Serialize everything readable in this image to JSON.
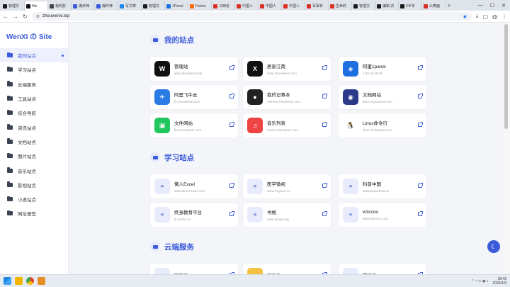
{
  "browser": {
    "tabs": [
      {
        "label": "管理文",
        "color": "#1a1a1a"
      },
      {
        "label": "We",
        "color": "#111111",
        "active": true
      },
      {
        "label": "我的影",
        "color": "#444444"
      },
      {
        "label": "爆炸神",
        "color": "#3b5bdb"
      },
      {
        "label": "爆炸神",
        "color": "#3b5bdb"
      },
      {
        "label": "写文章",
        "color": "#1e88e5"
      },
      {
        "label": "管理文",
        "color": "#1a1a1a"
      },
      {
        "label": "1Panel",
        "color": "#1e6fe0"
      },
      {
        "label": "Favico",
        "color": "#ff6a00"
      },
      {
        "label": "江西省",
        "color": "#d93025"
      },
      {
        "label": "中国人",
        "color": "#d93025"
      },
      {
        "label": "中国人",
        "color": "#d93025"
      },
      {
        "label": "中国人",
        "color": "#d93025"
      },
      {
        "label": "军事科",
        "color": "#d93025"
      },
      {
        "label": "生命的",
        "color": "#d93025"
      },
      {
        "label": "管理文",
        "color": "#1a1a1a"
      },
      {
        "label": "编辑 衣",
        "color": "#1a1a1a"
      },
      {
        "label": "3半年",
        "color": "#1a1a1a"
      },
      {
        "label": "公寓面",
        "color": "#d93025"
      }
    ],
    "url": "zhouwenxi.top"
  },
  "sidebar": {
    "logo": "WenXI の Site",
    "items": [
      {
        "label": "我的站点",
        "active": true
      },
      {
        "label": "学习站点"
      },
      {
        "label": "云端服务"
      },
      {
        "label": "工具站点"
      },
      {
        "label": "综合导航"
      },
      {
        "label": "资讯站点"
      },
      {
        "label": "文档站点"
      },
      {
        "label": "图片站点"
      },
      {
        "label": "音乐站点"
      },
      {
        "label": "影视站点"
      },
      {
        "label": "小说站点"
      },
      {
        "label": "网址便签"
      }
    ]
  },
  "sections": [
    {
      "title": "我的站点",
      "cards": [
        {
          "name": "管理站",
          "url": "www.zhouwenxi.top",
          "icon": "W",
          "bg": "#111111"
        },
        {
          "name": "居家江南",
          "url": "www.zhouwenxi.com",
          "icon": "X",
          "bg": "#111111"
        },
        {
          "name": "阿里1panel",
          "url": "1.92.26.48.93",
          "icon": "◈",
          "bg": "#1e6fe0"
        },
        {
          "name": "阿里飞牛云",
          "url": "fn.zhouwenxi.com",
          "icon": "✈",
          "bg": "#2a7be4"
        },
        {
          "name": "我的记事本",
          "url": "memos.zhouwenxi.com",
          "icon": "●",
          "bg": "#222222"
        },
        {
          "name": "文档网站",
          "url": "docs.zhouwenxi.com",
          "icon": "◉",
          "bg": "#2c3a8c"
        },
        {
          "name": "文件网站",
          "url": "file.zhouwenxi.com",
          "icon": "▣",
          "bg": "#22c55e"
        },
        {
          "name": "音乐列表",
          "url": "music.zhouwenxi.com",
          "icon": "♫",
          "bg": "#ef4444"
        },
        {
          "name": "Linux命令行",
          "url": "linux.zhouwenxi.com",
          "icon": "🐧",
          "bg": "#ffffff"
        }
      ]
    },
    {
      "title": "学习站点",
      "cards": [
        {
          "name": "懒人Excel",
          "url": "www.lanrenexcel.com",
          "icon": "⚭",
          "bg": "link"
        },
        {
          "name": "医学微视",
          "url": "www.mvyxws.cn",
          "icon": "⚭",
          "bg": "link"
        },
        {
          "name": "科普中国",
          "url": "www.kepuchina.cn",
          "icon": "⚭",
          "bg": "link"
        },
        {
          "name": "终身教育平台",
          "url": "le.ouchn.cn",
          "icon": "⚭",
          "bg": "link"
        },
        {
          "name": "书格",
          "url": "www.shuge.org",
          "icon": "⚭",
          "bg": "link"
        },
        {
          "name": "w3ccoo",
          "url": "www.w3ccoo.com",
          "icon": "⚭",
          "bg": "link"
        }
      ]
    },
    {
      "title": "云端服务",
      "cards": [
        {
          "name": "阿里云",
          "url": "",
          "icon": "⚭",
          "bg": "link"
        },
        {
          "name": "蓝奏云",
          "url": "",
          "icon": "☁",
          "bg": "#f5c242"
        },
        {
          "name": "腾讯云",
          "url": "",
          "icon": "⚭",
          "bg": "link"
        }
      ]
    }
  ],
  "taskbar": {
    "time": "18:42",
    "date": "2025/1/9"
  }
}
